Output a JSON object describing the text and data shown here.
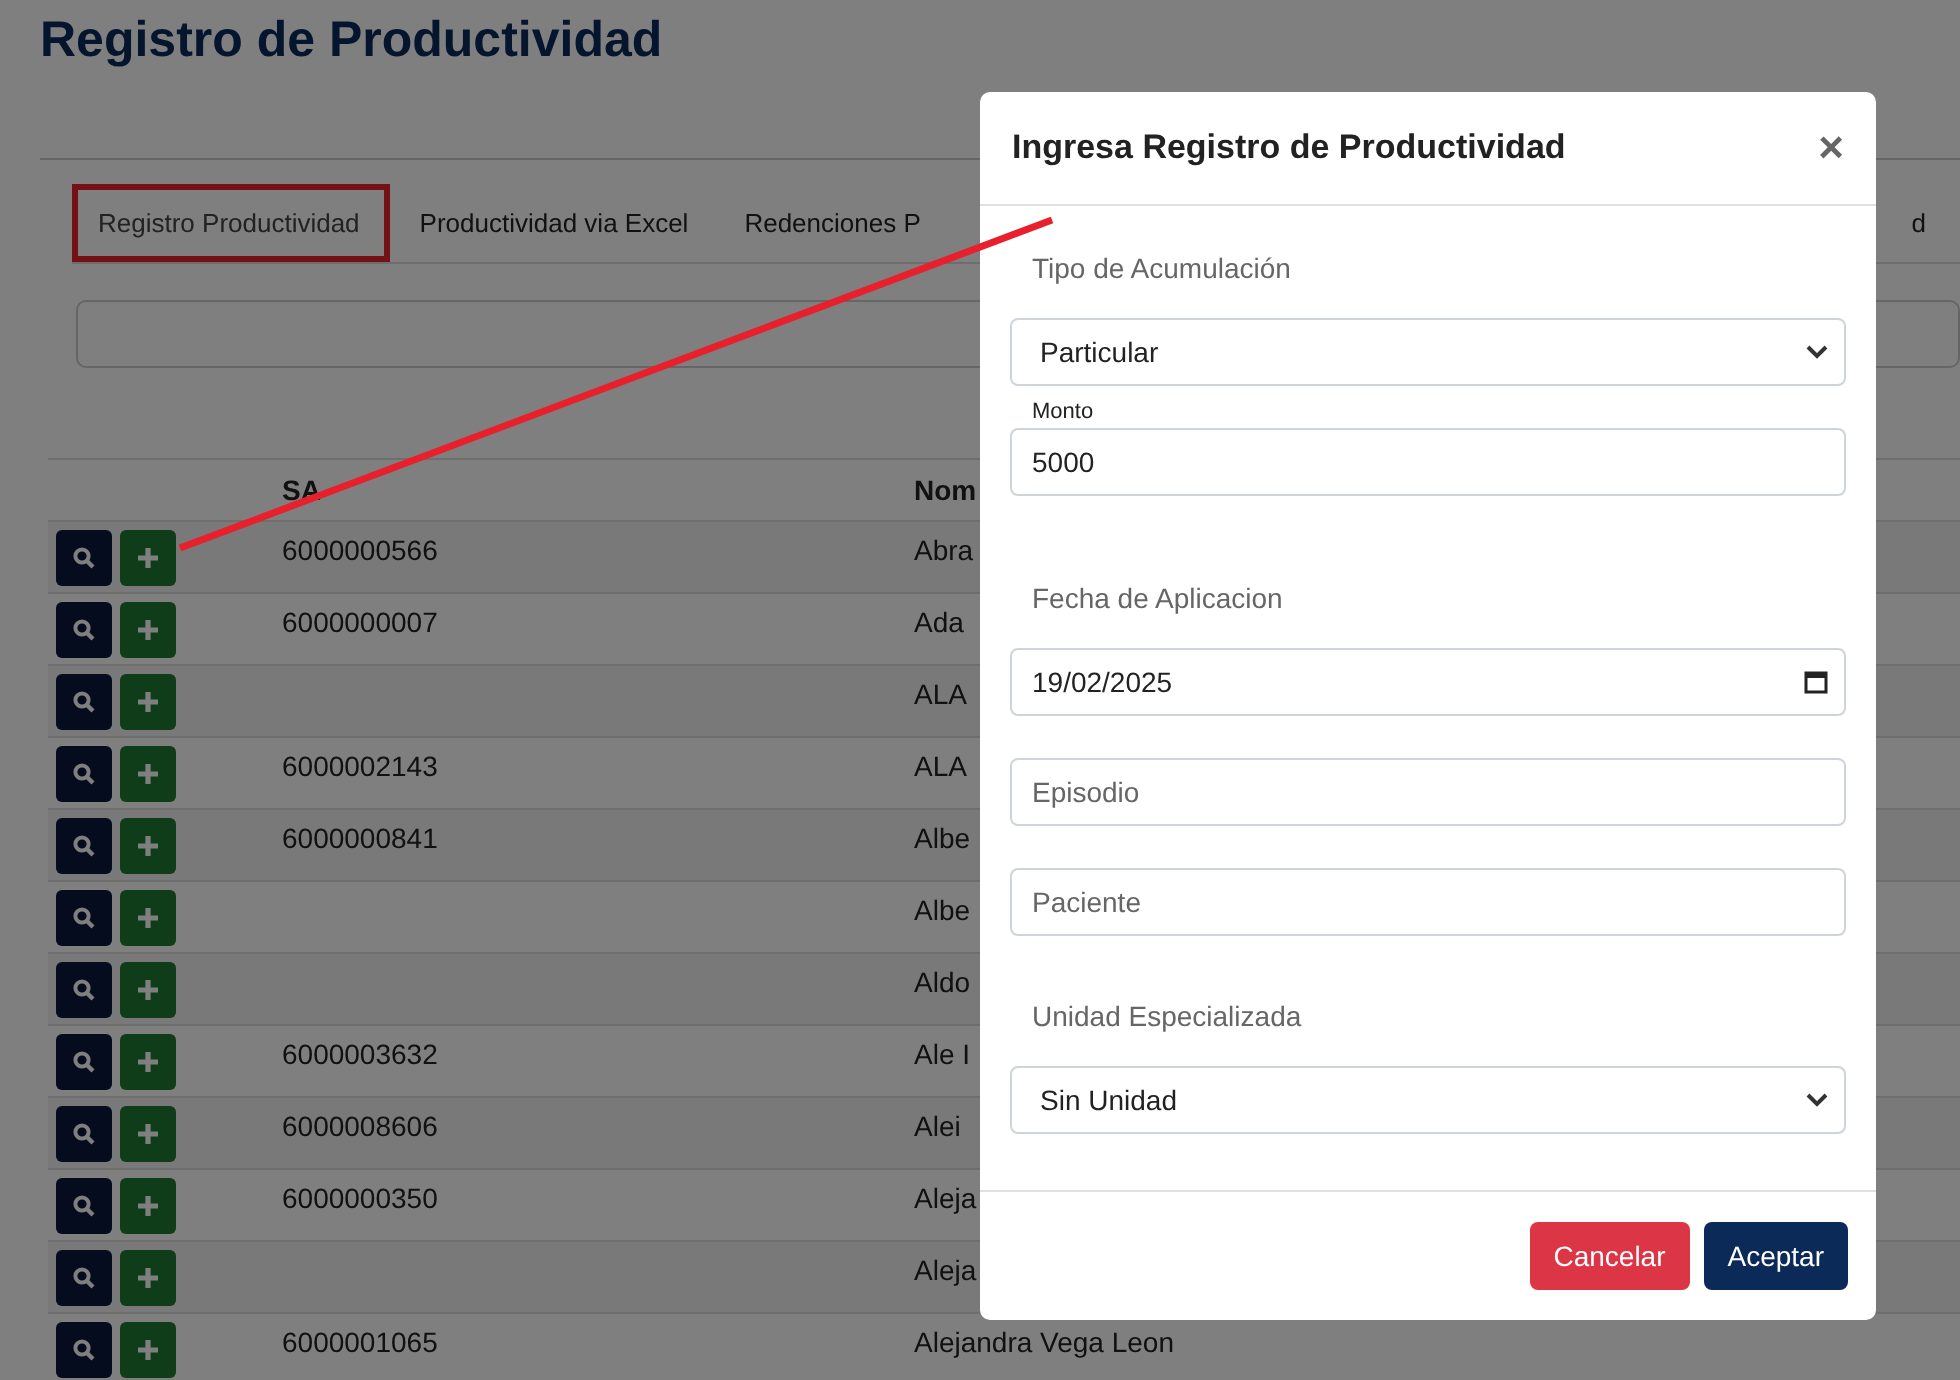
{
  "page_title": "Registro de Productividad",
  "tabs": [
    {
      "label": "Registro Productividad",
      "selected": true,
      "highlighted": true
    },
    {
      "label": "Productividad via Excel",
      "selected": false,
      "highlighted": false
    },
    {
      "label": "Redenciones P",
      "selected": false,
      "highlighted": false
    },
    {
      "label": "d",
      "selected": false,
      "highlighted": false
    }
  ],
  "table": {
    "columns": [
      "SA",
      "Nom"
    ],
    "rows": [
      {
        "sap": "6000000566",
        "name": "Abra"
      },
      {
        "sap": "6000000007",
        "name": "Ada"
      },
      {
        "sap": "",
        "name": "ALA"
      },
      {
        "sap": "6000002143",
        "name": "ALA"
      },
      {
        "sap": "6000000841",
        "name": "Albe"
      },
      {
        "sap": "",
        "name": "Albe"
      },
      {
        "sap": "",
        "name": "Aldo"
      },
      {
        "sap": "6000003632",
        "name": "Ale I"
      },
      {
        "sap": "6000008606",
        "name": "Alei"
      },
      {
        "sap": "6000000350",
        "name": "Aleja"
      },
      {
        "sap": "",
        "name": "Aleja"
      },
      {
        "sap": "6000001065",
        "name": "Alejandra Vega Leon"
      }
    ]
  },
  "modal": {
    "title": "Ingresa Registro de Productividad",
    "close": "×",
    "fields": [
      {
        "kind": "select",
        "label": "Tipo de Acumulación",
        "value": "Particular"
      },
      {
        "kind": "input",
        "small_label": "Monto",
        "value": "5000"
      },
      {
        "kind": "date",
        "label": "Fecha de Aplicacion",
        "value": "19/02/2025"
      },
      {
        "kind": "input",
        "placeholder": "Episodio"
      },
      {
        "kind": "input",
        "placeholder": "Paciente"
      },
      {
        "kind": "select",
        "label": "Unidad Especializada",
        "value": "Sin Unidad"
      }
    ],
    "buttons": [
      {
        "label": "Cancelar",
        "kind": "danger"
      },
      {
        "label": "Aceptar",
        "kind": "primary"
      }
    ]
  }
}
